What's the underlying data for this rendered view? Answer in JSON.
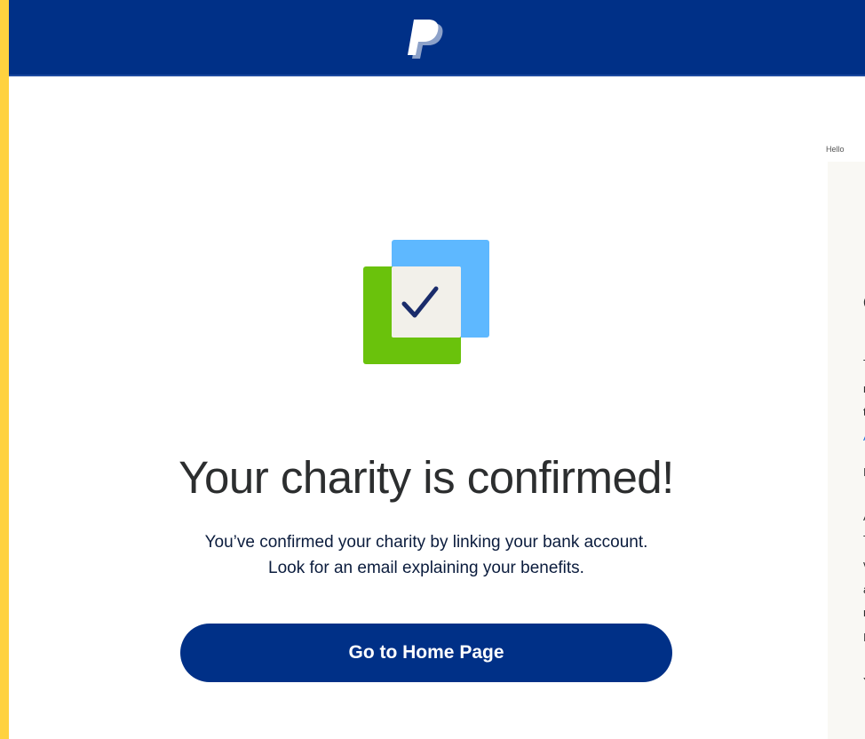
{
  "header": {
    "logo_icon": "paypal-logo-icon",
    "background_color": "#003087"
  },
  "side_panel": {
    "greeting": "Hello"
  },
  "main": {
    "illustration_icon": "confirmed-checkbox-icon",
    "title": "Your charity is confirmed!",
    "message_line1": "You’ve confirmed your charity by linking your bank account.",
    "message_line2": "Look for an email explaining your benefits.",
    "home_button_label": "Go to Home Page"
  },
  "colors": {
    "brand_blue": "#003087",
    "accent_green": "#6ac20c",
    "accent_light_blue": "#5eb8ff",
    "page_border": "#FFD23F"
  }
}
